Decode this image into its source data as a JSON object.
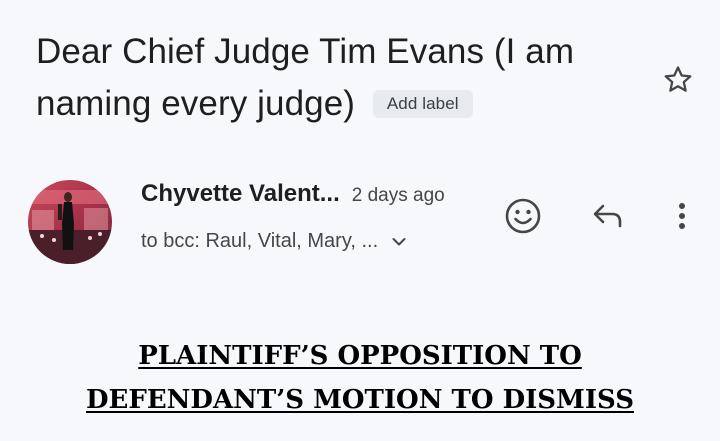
{
  "email": {
    "subject": "Dear Chief Judge Tim Evans (I am naming every judge)",
    "label_button": "Add label",
    "sender_name": "Chyvette Valent...",
    "time": "2 days ago",
    "recipients": "to bcc: Raul, Vital, Mary, ...",
    "body_heading_line1": "PLAINTIFF’S OPPOSITION TO",
    "body_heading_line2": "DEFENDANT’S MOTION TO DISMISS"
  },
  "icons": {
    "star": "star-outline-icon",
    "emoji": "emoji-react-icon",
    "reply": "reply-icon",
    "more": "more-vert-icon",
    "expand": "chevron-down-icon"
  },
  "colors": {
    "background": "#f6f8fc",
    "text_primary": "#1f1f1f",
    "text_secondary": "#444746",
    "chip_bg": "#e7eaee"
  }
}
